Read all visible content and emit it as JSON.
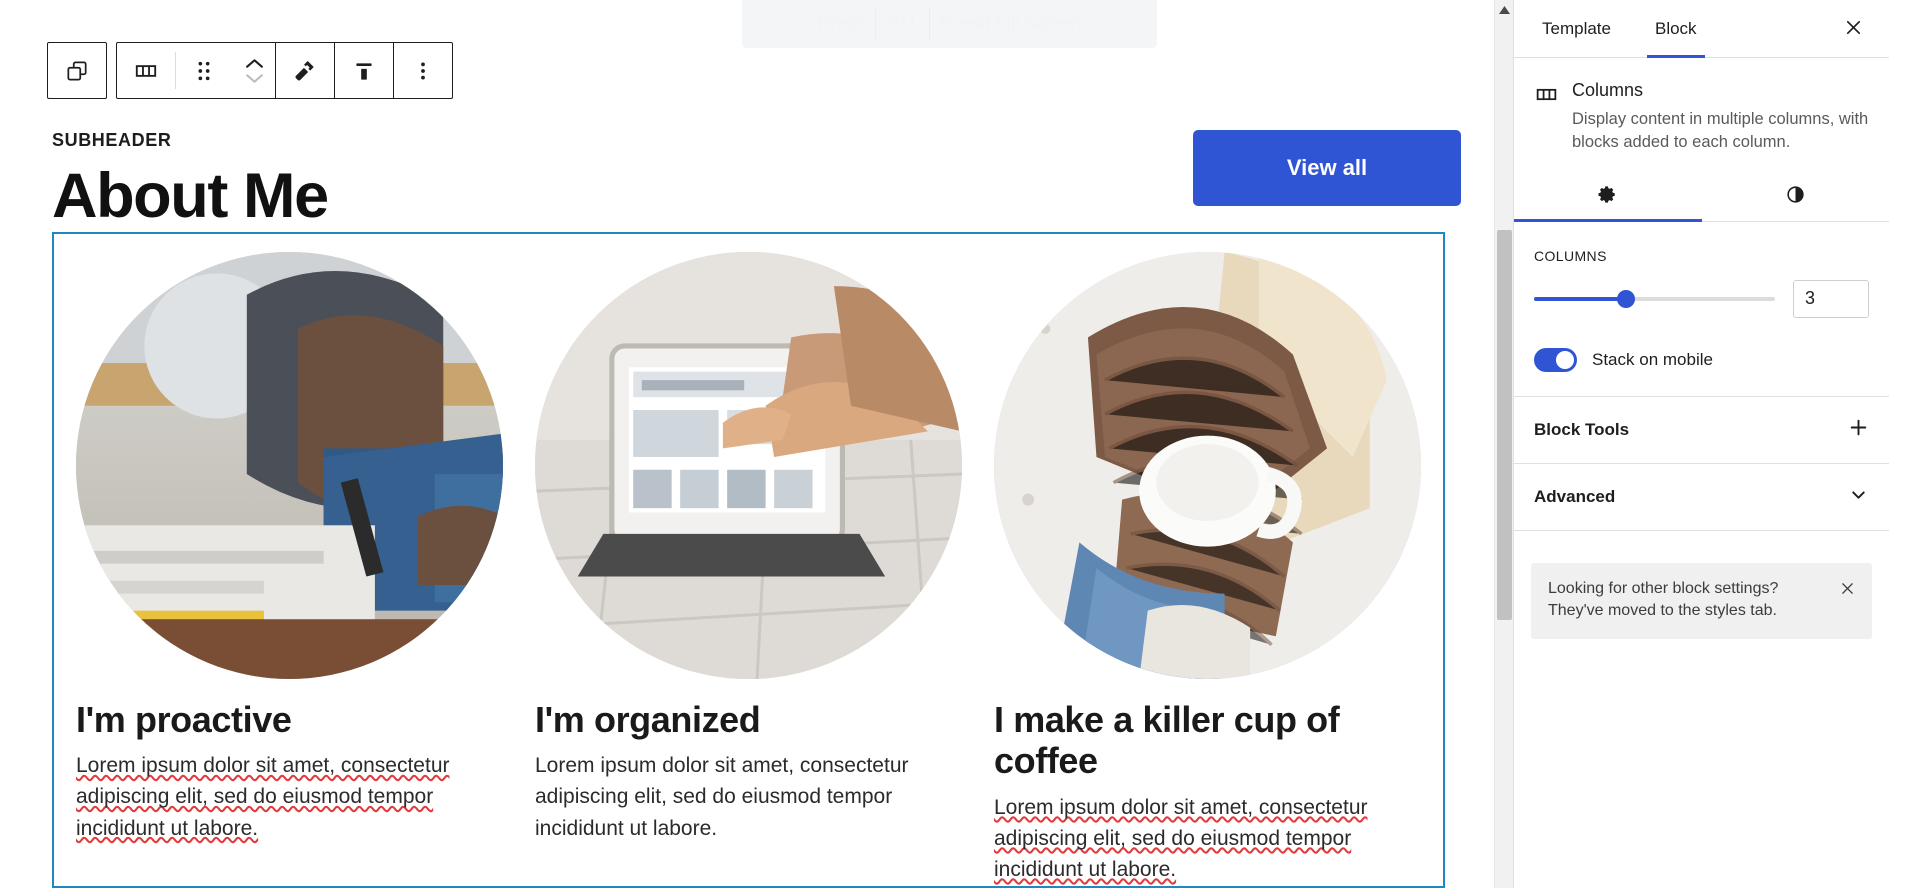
{
  "fullscreen_hint": {
    "prefix": "Press",
    "key": "F11",
    "suffix": "to exit full screen"
  },
  "toolbar": {
    "buttons": [
      {
        "name": "block-type-switcher",
        "icon": "copy-blocks-icon",
        "label": "Change block type"
      },
      {
        "name": "columns-icon-button",
        "icon": "columns-icon",
        "label": "Columns"
      },
      {
        "name": "drag-handle",
        "icon": "drag-dots-icon",
        "label": "Drag"
      },
      {
        "name": "move-up-down",
        "icon": "chevron-up-down-icon",
        "label": "Move up or down"
      },
      {
        "name": "style-tool",
        "icon": "hammer-icon",
        "label": "Styles"
      },
      {
        "name": "vertical-align",
        "icon": "align-top-icon",
        "label": "Change vertical alignment"
      },
      {
        "name": "more-options",
        "icon": "ellipsis-vertical-icon",
        "label": "Options"
      }
    ]
  },
  "page": {
    "subheader": "SUBHEADER",
    "title": "About Me",
    "view_all_label": "View all",
    "accent_button_color": "#2f55d4",
    "selection_border_color": "#1e88c7"
  },
  "columns": [
    {
      "image_alt": "Person writing in a notebook at a desk",
      "heading": "I'm proactive",
      "paragraph": "Lorem ipsum dolor sit amet, consectetur adipiscing elit, sed do eiusmod tempor incididunt ut labore.",
      "spellcheck": true
    },
    {
      "image_alt": "Hand pointing at a tablet screen on a stand",
      "heading": "I'm organized",
      "paragraph": "Lorem ipsum dolor sit amet, consectetur adipiscing elit, sed do eiusmod tempor incididunt ut labore.",
      "spellcheck": false
    },
    {
      "image_alt": "Person in a brown knit sweater holding a white mug",
      "heading": "I make a killer cup of coffee",
      "paragraph": "Lorem ipsum dolor sit amet, consectetur adipiscing elit, sed do eiusmod tempor incididunt ut labore.",
      "spellcheck": true
    }
  ],
  "sidebar": {
    "tabs": [
      {
        "label": "Template",
        "active": false
      },
      {
        "label": "Block",
        "active": true
      }
    ],
    "close_label": "Close settings",
    "block_card": {
      "icon": "columns-icon",
      "title": "Columns",
      "description": "Display content in multiple columns, with blocks added to each column."
    },
    "sub_tabs": [
      {
        "name": "settings",
        "icon": "gear-icon",
        "active": true
      },
      {
        "name": "styles",
        "icon": "contrast-half-circle-icon",
        "active": false
      }
    ],
    "columns_setting": {
      "label": "COLUMNS",
      "value": "3",
      "slider_percent": 38,
      "accent": "#2f55d4"
    },
    "stack_on_mobile": {
      "label": "Stack on mobile",
      "enabled": true
    },
    "rows": [
      {
        "title": "Block Tools",
        "icon": "plus-icon"
      },
      {
        "title": "Advanced",
        "icon": "chevron-down-icon"
      }
    ],
    "notice": {
      "text": "Looking for other block settings? They've moved to the styles tab.",
      "dismiss_label": "Dismiss"
    }
  }
}
